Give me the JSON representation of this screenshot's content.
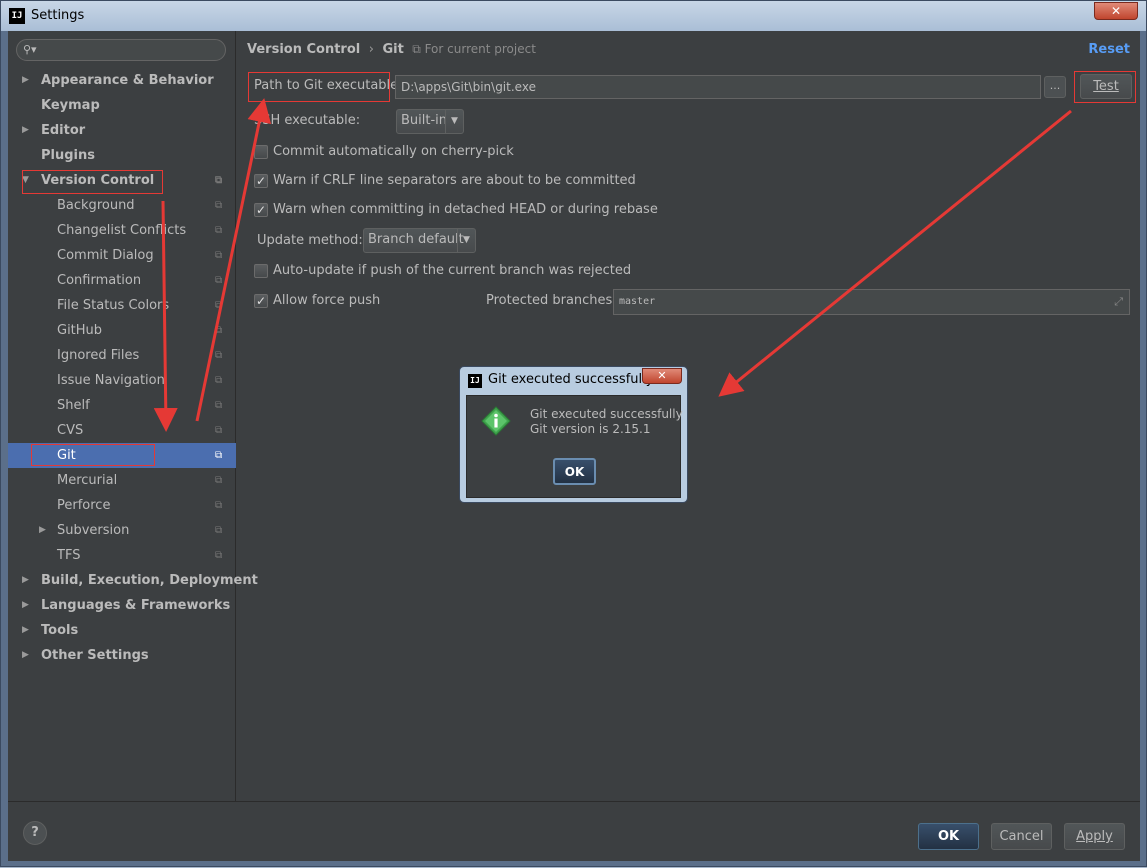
{
  "window": {
    "title": "Settings",
    "app_icon": "IJ",
    "close_label": "✕"
  },
  "sidebar": {
    "search_placeholder": "",
    "items": [
      {
        "label": "Appearance & Behavior",
        "bold": true,
        "arrow": "▶"
      },
      {
        "label": "Keymap",
        "bold": true
      },
      {
        "label": "Editor",
        "bold": true,
        "arrow": "▶"
      },
      {
        "label": "Plugins",
        "bold": true
      },
      {
        "label": "Version Control",
        "bold": true,
        "arrow": "▼"
      },
      {
        "label": "Background"
      },
      {
        "label": "Changelist Conflicts"
      },
      {
        "label": "Commit Dialog"
      },
      {
        "label": "Confirmation"
      },
      {
        "label": "File Status Colors"
      },
      {
        "label": "GitHub"
      },
      {
        "label": "Ignored Files"
      },
      {
        "label": "Issue Navigation"
      },
      {
        "label": "Shelf"
      },
      {
        "label": "CVS"
      },
      {
        "label": "Git",
        "selected": true
      },
      {
        "label": "Mercurial"
      },
      {
        "label": "Perforce"
      },
      {
        "label": "Subversion",
        "arrow": "▶"
      },
      {
        "label": "TFS"
      },
      {
        "label": "Build, Execution, Deployment",
        "bold": true,
        "arrow": "▶"
      },
      {
        "label": "Languages & Frameworks",
        "bold": true,
        "arrow": "▶"
      },
      {
        "label": "Tools",
        "bold": true,
        "arrow": "▶"
      },
      {
        "label": "Other Settings",
        "bold": true,
        "arrow": "▶"
      }
    ]
  },
  "header": {
    "crumb_parent": "Version Control",
    "crumb_sep": "›",
    "crumb_current": "Git",
    "scope": "For current project",
    "reset": "Reset"
  },
  "git": {
    "path_label": "Path to Git executable:",
    "path_value": "D:\\apps\\Git\\bin\\git.exe",
    "browse": "...",
    "test": "Test",
    "ssh_label": "SSH executable:",
    "ssh_value": "Built-in",
    "cherry_pick": "Commit automatically on cherry-pick",
    "crlf": "Warn if CRLF line separators are about to be committed",
    "detached": "Warn when committing in detached HEAD or during rebase",
    "update_label": "Update method:",
    "update_value": "Branch default",
    "auto_update": "Auto-update if push of the current branch was rejected",
    "force_push": "Allow force push",
    "protected_label": "Protected branches:",
    "protected_value": "master",
    "checked_mark": "✓"
  },
  "footer": {
    "help": "?",
    "ok": "OK",
    "cancel": "Cancel",
    "apply": "Apply"
  },
  "dialog": {
    "title": "Git executed successfully",
    "line1": "Git executed successfully",
    "line2": "Git version is 2.15.1",
    "ok": "OK"
  },
  "colors": {
    "selection": "#4b6eaf",
    "annotation_red": "#e53935",
    "link": "#589df6"
  }
}
